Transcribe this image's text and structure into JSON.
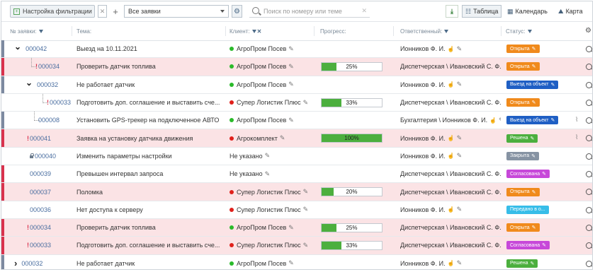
{
  "toolbar": {
    "filter_label": "Настройка фильтрации",
    "filter_value": "Все заявки",
    "search_placeholder": "Поиск по номеру или теме",
    "view_table": "Таблица",
    "view_calendar": "Календарь",
    "view_map": "Карта",
    "export_icon": "excel-export-icon"
  },
  "columns": {
    "number": "№ заявки:",
    "topic": "Тема:",
    "client": "Клиент:",
    "progress": "Прогресс:",
    "responsible": "Ответственный:",
    "status": "Статус:"
  },
  "colors": {
    "open": "#f08a1c",
    "onsite": "#1f5fc4",
    "solved": "#4caf3e",
    "closed": "#8693a3",
    "approved": "#c748d9",
    "handed": "#37bde8",
    "priority_bar": "#d9324d",
    "row_highlight": "#fbe3e5"
  },
  "rows": [
    {
      "num": "000042",
      "topic": "Выезд на 10.11.2021",
      "client": "АгроПром Посев",
      "progress": "",
      "resp": "Ионников Ф. И.",
      "status": "Открыта"
    },
    {
      "num": "000034",
      "topic": "Проверить датчик топлива",
      "client": "АгроПром Посев",
      "progress": "25%",
      "resp": "Диспетчерская \\ Ивановский С. Ф.",
      "status": "Открыта"
    },
    {
      "num": "000032",
      "topic": "Не работает датчик",
      "client": "АгроПром Посев",
      "progress": "",
      "resp": "Ионников Ф. И.",
      "status": "Выезд на объект"
    },
    {
      "num": "000033",
      "topic": "Подготовить доп. соглашение и выставить сче...",
      "client": "Супер Логистик Плюс",
      "progress": "33%",
      "resp": "Диспетчерская \\ Ивановский С. Ф.",
      "status": "Открыта"
    },
    {
      "num": "000008",
      "topic": "Установить GPS-трекер на подключенное АВТО",
      "client": "АгроПром Посев",
      "progress": "",
      "resp": "Бухгалтерия \\ Ионников Ф. И.",
      "status": "Выезд на объект"
    },
    {
      "num": "000041",
      "topic": "Заявка на установку датчика движения",
      "client": "Агрокомплект",
      "progress": "100%",
      "resp": "Ионников Ф. И.",
      "status": "Решена"
    },
    {
      "num": "000040",
      "topic": "Изменить параметры настройки",
      "client": "Не указано",
      "progress": "",
      "resp": "Ионников Ф. И.",
      "status": "Закрыта"
    },
    {
      "num": "000039",
      "topic": "Превышен интервал запроса",
      "client": "Не указано",
      "progress": "",
      "resp": "Диспетчерская \\ Ивановский С. Ф.",
      "status": "Согласована"
    },
    {
      "num": "000037",
      "topic": "Поломка",
      "client": "Супер Логистик Плюс",
      "progress": "20%",
      "resp": "Диспетчерская \\ Ивановский С. Ф.",
      "status": "Открыта"
    },
    {
      "num": "000036",
      "topic": "Нет доступа к серверу",
      "client": "Супер Логистик Плюс",
      "progress": "",
      "resp": "Ионников Ф. И.",
      "status": "Передано в о..."
    },
    {
      "num": "000034",
      "topic": "Проверить датчик топлива",
      "client": "АгроПром Посев",
      "progress": "25%",
      "resp": "Диспетчерская \\ Ивановский С. Ф.",
      "status": "Открыта"
    },
    {
      "num": "000033",
      "topic": "Подготовить доп. соглашение и выставить сче...",
      "client": "Супер Логистик Плюс",
      "progress": "33%",
      "resp": "Диспетчерская \\ Ивановский С. Ф.",
      "status": "Согласована"
    },
    {
      "num": "000032",
      "topic": "Не работает датчик",
      "client": "АгроПром Посев",
      "progress": "",
      "resp": "Ионников Ф. И.",
      "status": "Решена"
    }
  ]
}
